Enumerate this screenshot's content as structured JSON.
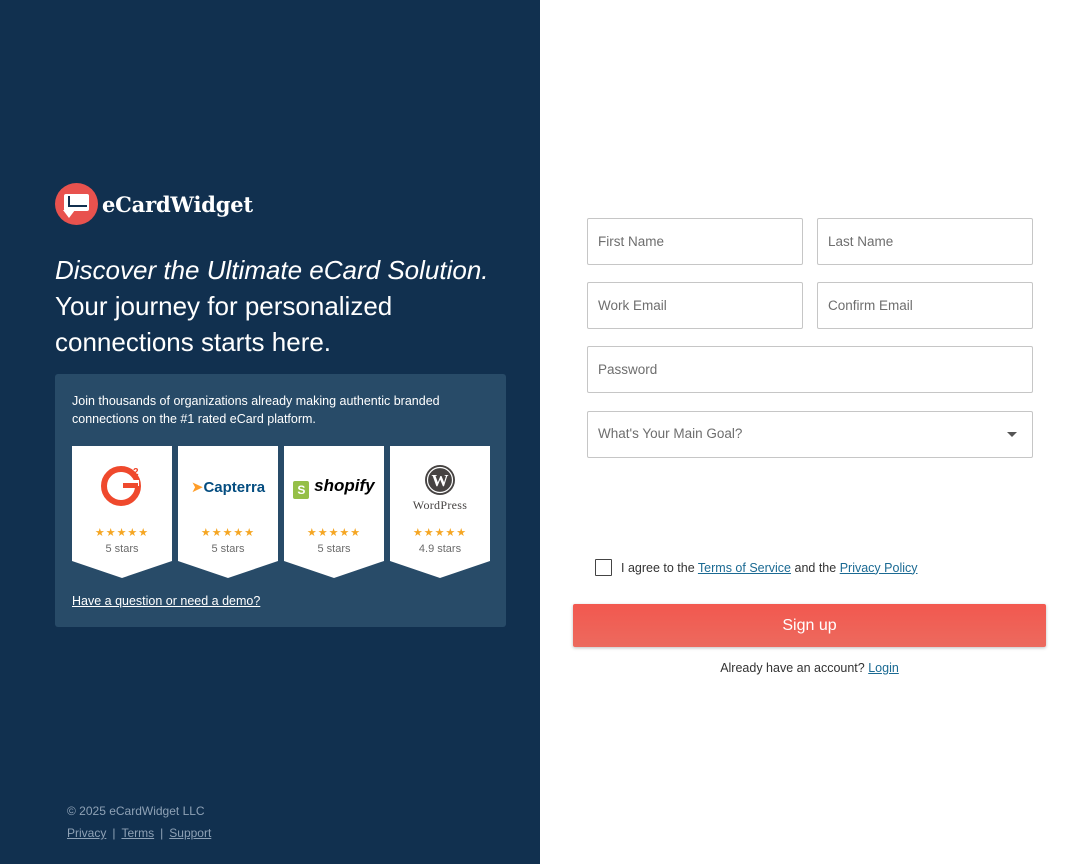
{
  "brand": {
    "name": "eCardWidget"
  },
  "headline": {
    "line1": "Discover the Ultimate eCard Solution.",
    "line2": "Your journey for personalized connections starts here."
  },
  "reviews": {
    "intro": "Join thousands of organizations already making authentic branded connections on the #1 rated eCard platform.",
    "badges": [
      {
        "name": "G2",
        "logo_text": "G2",
        "stars": "★★★★★",
        "rating": "5 stars",
        "color": "#ef492d"
      },
      {
        "name": "Capterra",
        "logo_text": "Capterra",
        "stars": "★★★★★",
        "rating": "5 stars",
        "color": "#044d80"
      },
      {
        "name": "shopify",
        "logo_text": "shopify",
        "stars": "★★★★★",
        "rating": "5 stars",
        "color": "#95bf47"
      },
      {
        "name": "WordPress",
        "logo_text": "WordPress",
        "stars": "★★★★★",
        "rating": "4.9 stars",
        "color": "#464342"
      }
    ],
    "demo_link": "Have a question or need a demo?"
  },
  "footer": {
    "copyright": "© 2025 eCardWidget LLC",
    "links": [
      "Privacy",
      "Terms",
      "Support"
    ]
  },
  "form": {
    "first_name": {
      "placeholder": "First Name",
      "value": ""
    },
    "last_name": {
      "placeholder": "Last Name",
      "value": ""
    },
    "work_email": {
      "placeholder": "Work Email",
      "value": ""
    },
    "confirm_email": {
      "placeholder": "Confirm Email",
      "value": ""
    },
    "password": {
      "placeholder": "Password",
      "value": ""
    },
    "goal": {
      "placeholder": "What's Your Main Goal?",
      "options": []
    },
    "agree": {
      "prefix": "I agree to the",
      "terms": "Terms of Service",
      "middle": "and the",
      "privacy": "Privacy Policy",
      "checked": false
    },
    "signup_label": "Sign up",
    "have_account": "Already have an account?",
    "login_link": "Login"
  },
  "colors": {
    "left_bg": "#11304f",
    "card_bg": "#284b68",
    "accent": "#f2584f",
    "link": "#1b6a93"
  }
}
